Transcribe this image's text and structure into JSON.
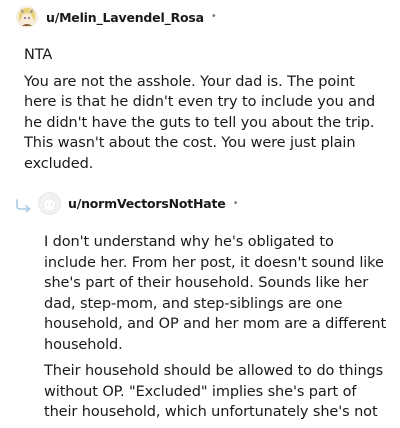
{
  "comment": {
    "username": "u/Melin_Lavendel_Rosa",
    "separator": "•",
    "paragraphs": [
      "NTA",
      "You are not the asshole. Your dad is. The point here is that he didn't even try to include you and he didn't have the guts to tell you about the trip. This wasn't about the cost. You were just plain excluded."
    ]
  },
  "reply": {
    "username": "u/normVectorsNotHate",
    "separator": "•",
    "paragraphs": [
      "I don't understand why he's obligated to include her. From her post, it doesn't sound like she's part of their household. Sounds like her dad, step-mom, and step-siblings are one household, and OP and her mom are a different household.",
      "Their household should be allowed to do things without OP. \"Excluded\" implies she's part of their household, which unfortunately she's not"
    ]
  },
  "icons": {
    "comment_avatar": "anime-character-avatar",
    "reply_avatar": "default-snoo-avatar",
    "reply_indicator": "reply-arrow-icon"
  }
}
